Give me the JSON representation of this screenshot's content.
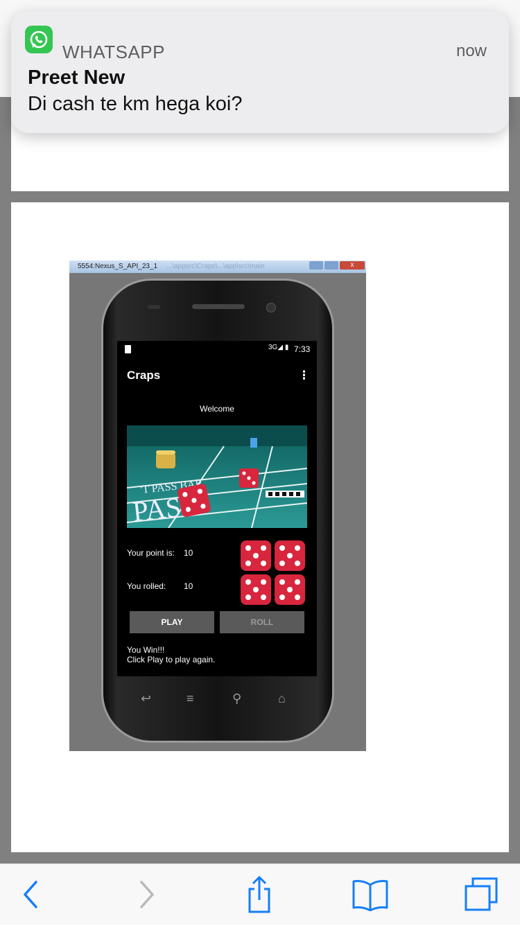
{
  "notification": {
    "app_name": "WHATSAPP",
    "time": "now",
    "sender": "Preet New",
    "message": "Di cash te km hega koi?",
    "icon": "whatsapp-icon"
  },
  "emulator": {
    "window_title": "5554:Nexus_S_API_23_1",
    "window_title_faded": "...\\appsrc\\Craps\\...\\app\\src\\main"
  },
  "app": {
    "status_time": "7:33",
    "status_signal": "3G",
    "title": "Craps",
    "welcome": "Welcome",
    "point_label": "Your point is:",
    "point_value": "10",
    "rolled_label": "You rolled:",
    "rolled_value": "10",
    "play_label": "PLAY",
    "roll_label": "ROLL",
    "result_line1": "You Win!!!",
    "result_line2": "Click Play to play again."
  },
  "toolbar": {
    "back": "back-icon",
    "forward": "forward-icon",
    "share": "share-icon",
    "bookmarks": "bookmarks-icon",
    "tabs": "tabs-icon"
  },
  "colors": {
    "whatsapp_green": "#35c553",
    "ios_blue": "#157efb",
    "dice_red": "#d7263d",
    "felt": "#1e7d7a"
  }
}
